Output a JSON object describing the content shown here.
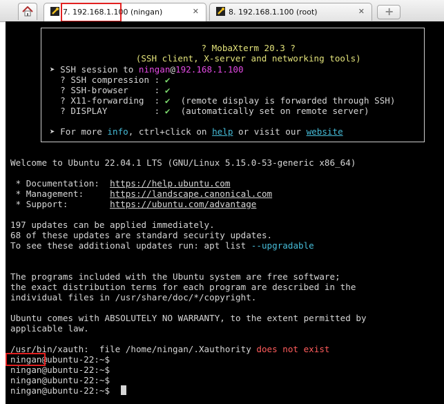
{
  "tabs": [
    {
      "label": "7. 192.168.1.100 (ningan)",
      "close": "✕",
      "active": true
    },
    {
      "label": "8. 192.168.1.100 (root)",
      "close": "✕",
      "active": false
    }
  ],
  "newtab_label": "+",
  "banner": {
    "title": "? MobaXterm 20.3 ?",
    "subtitle": "(SSH client, X-server and networking tools)",
    "session_prefix": "➤ SSH session to ",
    "session_user": "ningan",
    "session_at": "@",
    "session_host": "192.168.1.100",
    "checks": [
      {
        "label": "  ? SSH compression : ",
        "mark": "✔",
        "note": ""
      },
      {
        "label": "  ? SSH-browser     : ",
        "mark": "✔",
        "note": ""
      },
      {
        "label": "  ? X11-forwarding  : ",
        "mark": "✔",
        "note": "  (remote display is forwarded through SSH)"
      },
      {
        "label": "  ? DISPLAY         : ",
        "mark": "✔",
        "note": "  (automatically set on remote server)"
      }
    ],
    "info_prefix": "➤ For more ",
    "info_word": "info",
    "info_mid": ", ctrl+click on ",
    "help_link": "help",
    "info_mid2": " or visit our ",
    "website_link": "website"
  },
  "welcome": "Welcome to Ubuntu 22.04.1 LTS (GNU/Linux 5.15.0-53-generic x86_64)",
  "docs": [
    {
      "label": " * Documentation:  ",
      "url": "https://help.ubuntu.com"
    },
    {
      "label": " * Management:     ",
      "url": "https://landscape.canonical.com"
    },
    {
      "label": " * Support:        ",
      "url": "https://ubuntu.com/advantage"
    }
  ],
  "updates": {
    "line1": "197 updates can be applied immediately.",
    "line2": "68 of these updates are standard security updates.",
    "line3_prefix": "To see these additional updates run: apt list ",
    "line3_flag": "--upgradable"
  },
  "license": [
    "The programs included with the Ubuntu system are free software;",
    "the exact distribution terms for each program are described in the",
    "individual files in /usr/share/doc/*/copyright."
  ],
  "warranty": [
    "Ubuntu comes with ABSOLUTELY NO WARRANTY, to the extent permitted by",
    "applicable law."
  ],
  "xauth": {
    "prefix": "/usr/bin/xauth:  file /home/ningan/.Xauthority ",
    "error": "does not exist"
  },
  "prompts": [
    "ningan@ubuntu-22:~$",
    "ningan@ubuntu-22:~$",
    "ningan@ubuntu-22:~$",
    "ningan@ubuntu-22:~$ "
  ],
  "colors": {
    "terminal_bg": "#000000",
    "highlight_box": "#e22020",
    "banner_title": "#e2e27a",
    "check_mark": "#7bd86c",
    "host": "#e34ae3",
    "link": "#5aa0ff",
    "error": "#ff5c5c"
  }
}
